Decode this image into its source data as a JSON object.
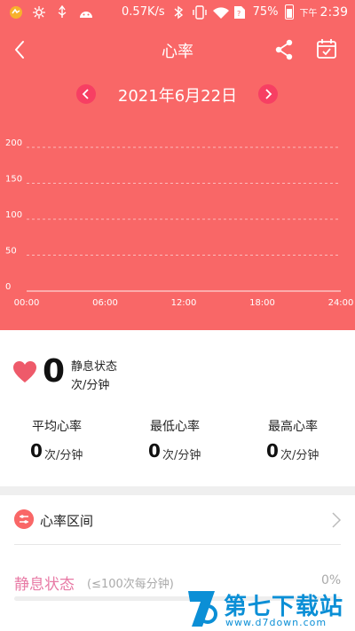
{
  "status_bar": {
    "speed": "0.57K/s",
    "battery": "75%",
    "ampm": "下午",
    "time": "2:39"
  },
  "header": {
    "title": "心率",
    "back_icon": "chevron-left-icon",
    "share_icon": "share-icon",
    "calendar_icon": "calendar-check-icon"
  },
  "date_nav": {
    "date": "2021年6月22日",
    "prev_icon": "chevron-left-icon",
    "next_icon": "chevron-right-icon"
  },
  "chart_data": {
    "type": "line",
    "title": "",
    "xlabel": "",
    "ylabel": "",
    "x_ticks": [
      "00:00",
      "06:00",
      "12:00",
      "18:00",
      "24:00"
    ],
    "y_ticks": [
      0,
      50,
      100,
      150,
      200
    ],
    "ylim": [
      0,
      200
    ],
    "grid": true,
    "series": [],
    "colors": {
      "background": "#f96767",
      "grid": "#ffffff"
    }
  },
  "current": {
    "value": "0",
    "state": "静息状态",
    "unit": "次/分钟"
  },
  "stats": [
    {
      "label": "平均心率",
      "value": "0",
      "unit": "次/分钟"
    },
    {
      "label": "最低心率",
      "value": "0",
      "unit": "次/分钟"
    },
    {
      "label": "最高心率",
      "value": "0",
      "unit": "次/分钟"
    }
  ],
  "zones": {
    "title": "心率区间",
    "rest": {
      "label": "静息状态",
      "range": "(≤100次每分钟)",
      "percent": "0%",
      "fraction": 0
    }
  },
  "watermark": {
    "name": "第七下载站",
    "url": "www.d7down.com"
  },
  "colors": {
    "accent": "#f96767",
    "date_button": "#f73f63",
    "heart": "#ee5a6a",
    "rest": "#e87aa5",
    "watermark": "#0b8fd6"
  }
}
